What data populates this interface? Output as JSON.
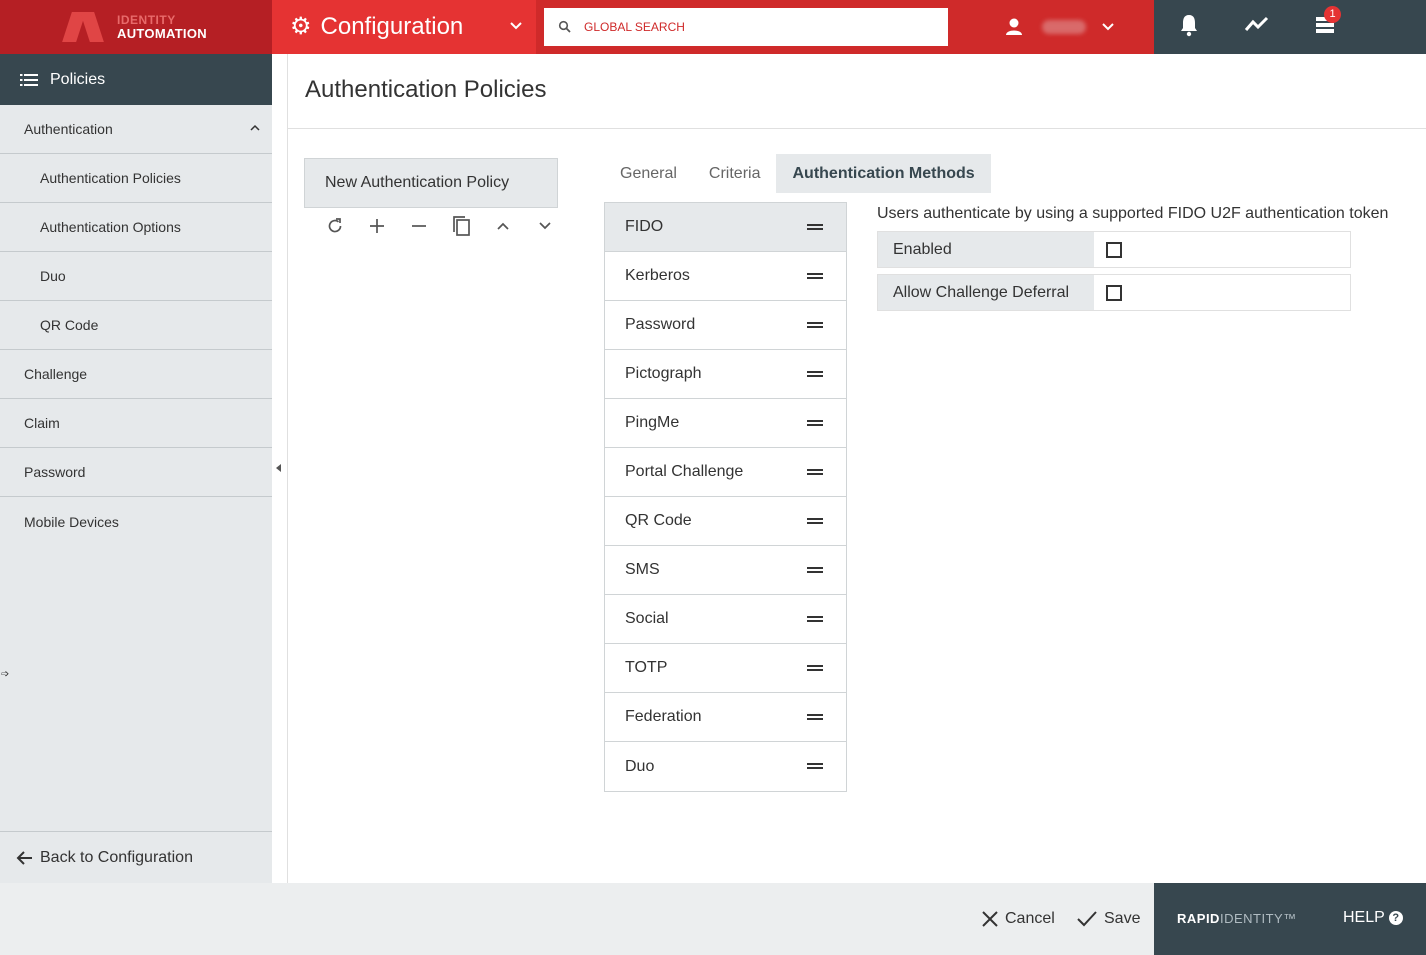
{
  "header": {
    "logo_line1": "IDENTITY",
    "logo_line2": "AUTOMATION",
    "module_title": "Configuration",
    "search_placeholder": "GLOBAL SEARCH",
    "icons": [
      "gear-icon",
      "chevron-down-icon",
      "search-icon",
      "user-icon",
      "bell-icon",
      "activity-icon",
      "tasks-icon"
    ],
    "notification_count": "1",
    "brand_color": "#cf2a2a",
    "dark_color": "#37474f"
  },
  "sidebar": {
    "title": "Policies",
    "items": [
      {
        "label": "Authentication",
        "level": 1,
        "expanded": true
      },
      {
        "label": "Authentication Policies",
        "level": 2
      },
      {
        "label": "Authentication Options",
        "level": 2
      },
      {
        "label": "Duo",
        "level": 2
      },
      {
        "label": "QR Code",
        "level": 2
      },
      {
        "label": "Challenge",
        "level": 1
      },
      {
        "label": "Claim",
        "level": 1
      },
      {
        "label": "Password",
        "level": 1
      },
      {
        "label": "Mobile Devices",
        "level": 1
      }
    ],
    "back_label": "Back to Configuration"
  },
  "main": {
    "page_title": "Authentication Policies",
    "policies": [
      "New Authentication Policy"
    ],
    "toolbar_icons": [
      "refresh-icon",
      "add-icon",
      "remove-icon",
      "copy-icon",
      "move-up-icon",
      "move-down-icon"
    ],
    "tabs": [
      "General",
      "Criteria",
      "Authentication Methods"
    ],
    "active_tab": "Authentication Methods",
    "methods": [
      "FIDO",
      "Kerberos",
      "Password",
      "Pictograph",
      "PingMe",
      "Portal Challenge",
      "QR Code",
      "SMS",
      "Social",
      "TOTP",
      "Federation",
      "Duo"
    ],
    "selected_method": "FIDO",
    "description": "Users authenticate by using a supported FIDO U2F authentication token",
    "properties": [
      {
        "label": "Enabled",
        "checked": false
      },
      {
        "label": "Allow Challenge Deferral",
        "checked": false
      }
    ]
  },
  "footer": {
    "cancel_label": "Cancel",
    "save_label": "Save",
    "brand_bold": "RAPID",
    "brand_light": "IDENTITY™",
    "help_label": "HELP"
  }
}
